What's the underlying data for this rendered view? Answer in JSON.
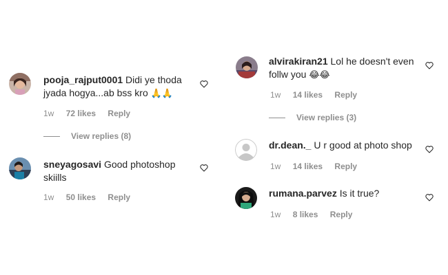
{
  "left_column": {
    "comments": [
      {
        "username": "pooja_rajput0001",
        "text": "Didi ye thoda jyada hogya...ab bss kro",
        "emoji": "🙏🙏",
        "time": "1w",
        "likes": "72 likes",
        "reply": "Reply",
        "view_replies": "View replies (8)"
      },
      {
        "username": "sneyagosavi",
        "text": "Good photoshop skiills",
        "time": "1w",
        "likes": "50 likes",
        "reply": "Reply"
      }
    ]
  },
  "right_column": {
    "comments": [
      {
        "username": "alvirakiran21",
        "text": "Lol he doesn't even follw you",
        "emoji": "😂😂",
        "time": "1w",
        "likes": "14 likes",
        "reply": "Reply",
        "view_replies": "View replies (3)"
      },
      {
        "username": "dr.dean._",
        "text": "U r good at photo shop",
        "time": "1w",
        "likes": "14 likes",
        "reply": "Reply"
      },
      {
        "username": "rumana.parvez",
        "text": "Is it true?",
        "time": "1w",
        "likes": "8 likes",
        "reply": "Reply"
      }
    ]
  },
  "icons": {
    "like": "heart-outline-icon",
    "default_avatar": "default-avatar-icon"
  },
  "colors": {
    "text": "#262626",
    "secondary": "#8e8e8e",
    "divider": "#efefef"
  }
}
